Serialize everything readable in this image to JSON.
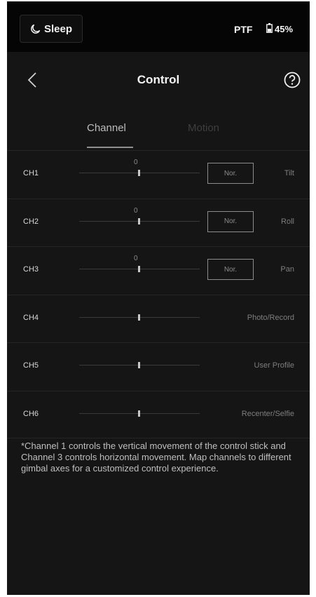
{
  "status": {
    "sleep_label": "Sleep",
    "mode": "PTF",
    "battery": "45%"
  },
  "header": {
    "title": "Control"
  },
  "tabs": [
    {
      "label": "Channel",
      "active": true
    },
    {
      "label": "Motion",
      "active": false
    }
  ],
  "channels": [
    {
      "label": "CH1",
      "value": "0",
      "mode_button": "Nor.",
      "function": "Tilt"
    },
    {
      "label": "CH2",
      "value": "0",
      "mode_button": "Nor.",
      "function": "Roll"
    },
    {
      "label": "CH3",
      "value": "0",
      "mode_button": "Nor.",
      "function": "Pan"
    },
    {
      "label": "CH4",
      "function": "Photo/Record"
    },
    {
      "label": "CH5",
      "function": "User Profile"
    },
    {
      "label": "CH6",
      "function": "Recenter/Selfie"
    }
  ],
  "note": "*Channel 1 controls the vertical movement of the control stick and Channel 3 controls horizontal movement. Map channels to different gimbal axes for a customized control experience.",
  "colors": {
    "background": "#151515",
    "statusbar": "#050505",
    "text_primary": "#f5f5f5",
    "text_muted": "#7e7e7e"
  }
}
